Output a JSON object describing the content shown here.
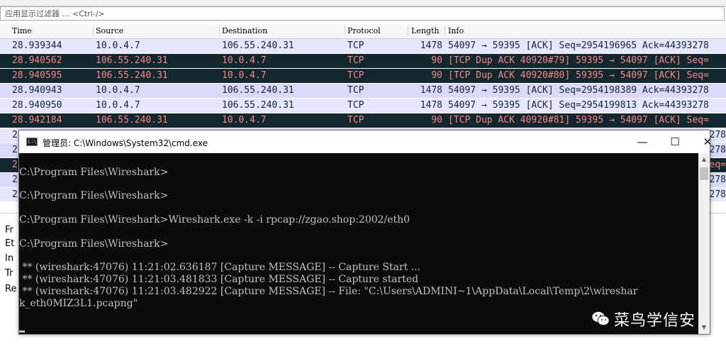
{
  "filter": {
    "placeholder": "应用显示过滤器 … <Ctrl-/>"
  },
  "columns": [
    "Time",
    "Source",
    "Destination",
    "Protocol",
    "Length",
    "Info"
  ],
  "packets": [
    {
      "time": "28.939344",
      "src": "10.0.4.7",
      "dst": "106.55.240.31",
      "proto": "TCP",
      "len": "1478",
      "info": "54097 → 59395 [ACK] Seq=2954196965 Ack=44393278",
      "kind": "ok"
    },
    {
      "time": "28.940562",
      "src": "106.55.240.31",
      "dst": "10.0.4.7",
      "proto": "TCP",
      "len": "90",
      "info": "[TCP Dup ACK 40920#79] 59395 → 54097 [ACK] Seq=",
      "kind": "bad"
    },
    {
      "time": "28.940595",
      "src": "106.55.240.31",
      "dst": "10.0.4.7",
      "proto": "TCP",
      "len": "90",
      "info": "[TCP Dup ACK 40920#80] 59395 → 54097 [ACK] Seq=",
      "kind": "bad"
    },
    {
      "time": "28.940943",
      "src": "10.0.4.7",
      "dst": "106.55.240.31",
      "proto": "TCP",
      "len": "1478",
      "info": "54097 → 59395 [ACK] Seq=2954198389 Ack=44393278",
      "kind": "ok"
    },
    {
      "time": "28.940950",
      "src": "10.0.4.7",
      "dst": "106.55.240.31",
      "proto": "TCP",
      "len": "1478",
      "info": "54097 → 59395 [ACK] Seq=2954199813 Ack=44393278",
      "kind": "ok"
    },
    {
      "time": "28.942184",
      "src": "106.55.240.31",
      "dst": "10.0.4.7",
      "proto": "TCP",
      "len": "90",
      "info": "[TCP Dup ACK 40920#81] 59395 → 54097 [ACK] Seq=",
      "kind": "bad"
    },
    {
      "time": "2",
      "src": "",
      "dst": "",
      "proto": "",
      "len": "",
      "info": "278",
      "kind": "ok"
    },
    {
      "time": "2",
      "src": "",
      "dst": "",
      "proto": "",
      "len": "",
      "info": "278",
      "kind": "ok"
    },
    {
      "time": "2",
      "src": "",
      "dst": "",
      "proto": "",
      "len": "",
      "info": "eq=",
      "kind": "bad"
    },
    {
      "time": "2",
      "src": "",
      "dst": "",
      "proto": "",
      "len": "",
      "info": "278",
      "kind": "ok"
    },
    {
      "time": "2",
      "src": "",
      "dst": "",
      "proto": "",
      "len": "",
      "info": "278",
      "kind": "ok"
    }
  ],
  "details": [
    "Fr",
    "Et",
    "In",
    "Tr",
    "Re"
  ],
  "cmd": {
    "icon_text": "C:\\_",
    "title": "管理员: C:\\Windows\\System32\\cmd.exe",
    "minimize": "—",
    "maximize": "☐",
    "close": "✕",
    "lines": [
      "",
      "C:\\Program Files\\Wireshark>",
      "",
      "C:\\Program Files\\Wireshark>",
      "",
      "C:\\Program Files\\Wireshark>Wireshark.exe -k -i rpcap://zgao.shop:2002/eth0",
      "",
      "C:\\Program Files\\Wireshark>",
      "",
      " ** (wireshark:47076) 11:21:02.636187 [Capture MESSAGE] -- Capture Start ...",
      " ** (wireshark:47076) 11:21:03.481833 [Capture MESSAGE] -- Capture started",
      " ** (wireshark:47076) 11:21:03.482922 [Capture MESSAGE] -- File: \"C:\\Users\\ADMINI~1\\AppData\\Local\\Temp\\2\\wireshar",
      "k_eth0MIZ3L1.pcapng\""
    ]
  },
  "watermark": {
    "text": "菜鸟学信安",
    "icon": "wechat-icon"
  }
}
